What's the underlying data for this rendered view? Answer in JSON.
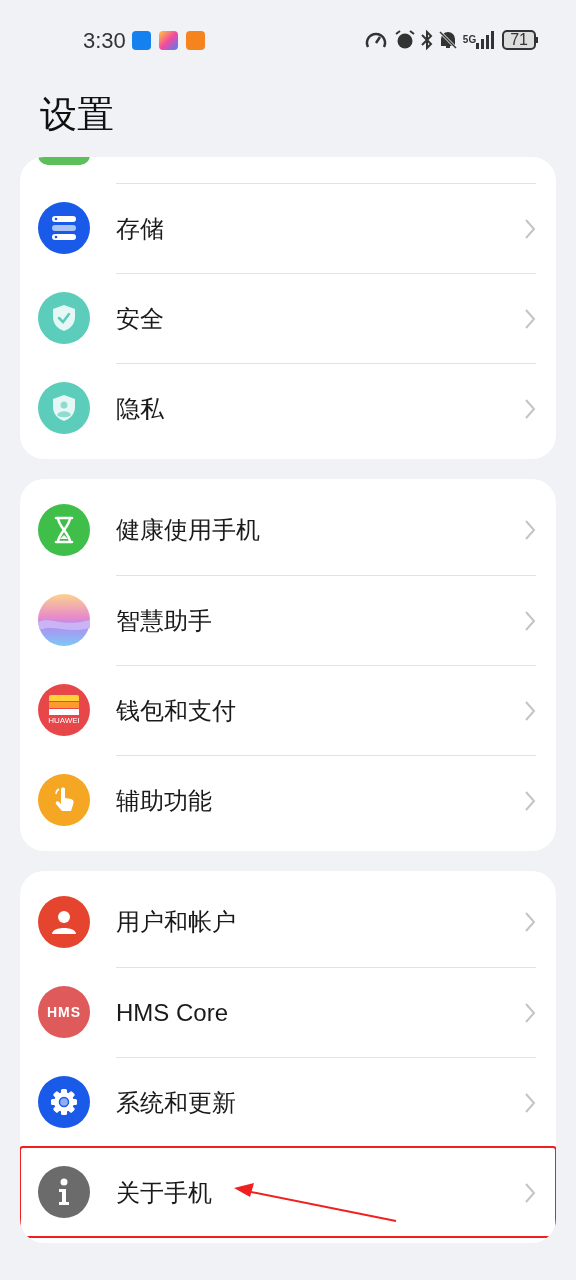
{
  "status_bar": {
    "time": "3:30",
    "network": "5G",
    "battery": "71"
  },
  "title": "设置",
  "groups": [
    {
      "partial_top": true,
      "items": [
        {
          "kind": "storage",
          "label": "存储",
          "highlighted": false
        },
        {
          "kind": "security",
          "label": "安全",
          "highlighted": false
        },
        {
          "kind": "privacy",
          "label": "隐私",
          "highlighted": false
        }
      ]
    },
    {
      "partial_top": false,
      "items": [
        {
          "kind": "hourglass",
          "label": "健康使用手机",
          "highlighted": false
        },
        {
          "kind": "assistant",
          "label": "智慧助手",
          "highlighted": false
        },
        {
          "kind": "wallet",
          "label": "钱包和支付",
          "icon_text": "HUAWEI",
          "highlighted": false
        },
        {
          "kind": "accessibility",
          "label": "辅助功能",
          "highlighted": false
        }
      ]
    },
    {
      "partial_top": false,
      "items": [
        {
          "kind": "user",
          "label": "用户和帐户",
          "highlighted": false
        },
        {
          "kind": "hms",
          "label": "HMS Core",
          "icon_text": "HMS",
          "highlighted": false
        },
        {
          "kind": "system",
          "label": "系统和更新",
          "highlighted": false
        },
        {
          "kind": "about",
          "label": "关于手机",
          "highlighted": true
        }
      ]
    }
  ]
}
